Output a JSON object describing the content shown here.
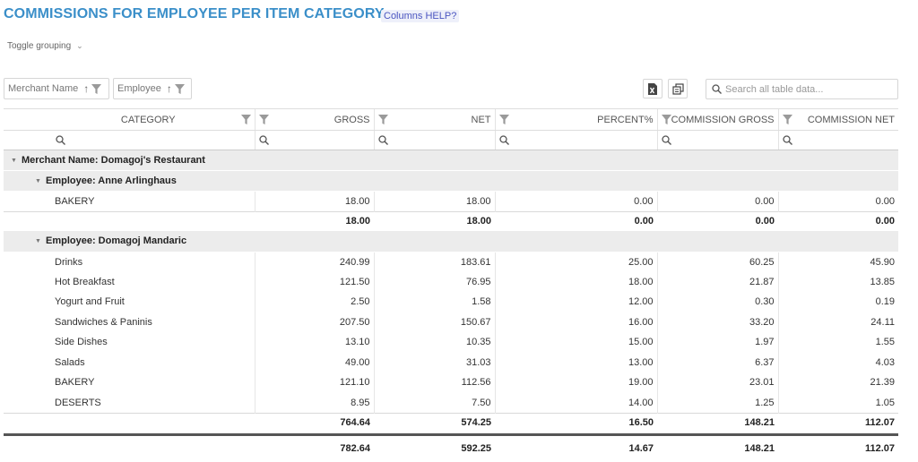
{
  "header": {
    "title": "COMMISSIONS FOR EMPLOYEE PER ITEM CATEGORY",
    "help_label": "Columns HELP?"
  },
  "toolbar": {
    "toggle_grouping": "Toggle grouping",
    "chips": [
      "Merchant Name",
      "Employee"
    ],
    "search_placeholder": "Search all table data..."
  },
  "columns": [
    "CATEGORY",
    "GROSS",
    "NET",
    "PERCENT%",
    "COMMISSION GROSS",
    "COMMISSION NET"
  ],
  "groups": [
    {
      "label": "Merchant Name: Domagoj's Restaurant",
      "employees": [
        {
          "label": "Employee: Anne Arlinghaus",
          "rows": [
            {
              "category": "BAKERY",
              "gross": "18.00",
              "net": "18.00",
              "percent": "0.00",
              "commission_gross": "0.00",
              "commission_net": "0.00"
            }
          ],
          "subtotal": {
            "gross": "18.00",
            "net": "18.00",
            "percent": "0.00",
            "commission_gross": "0.00",
            "commission_net": "0.00"
          }
        },
        {
          "label": "Employee: Domagoj Mandaric",
          "rows": [
            {
              "category": "Drinks",
              "gross": "240.99",
              "net": "183.61",
              "percent": "25.00",
              "commission_gross": "60.25",
              "commission_net": "45.90"
            },
            {
              "category": "Hot Breakfast",
              "gross": "121.50",
              "net": "76.95",
              "percent": "18.00",
              "commission_gross": "21.87",
              "commission_net": "13.85"
            },
            {
              "category": "Yogurt and Fruit",
              "gross": "2.50",
              "net": "1.58",
              "percent": "12.00",
              "commission_gross": "0.30",
              "commission_net": "0.19"
            },
            {
              "category": "Sandwiches & Paninis",
              "gross": "207.50",
              "net": "150.67",
              "percent": "16.00",
              "commission_gross": "33.20",
              "commission_net": "24.11"
            },
            {
              "category": "Side Dishes",
              "gross": "13.10",
              "net": "10.35",
              "percent": "15.00",
              "commission_gross": "1.97",
              "commission_net": "1.55"
            },
            {
              "category": "Salads",
              "gross": "49.00",
              "net": "31.03",
              "percent": "13.00",
              "commission_gross": "6.37",
              "commission_net": "4.03"
            },
            {
              "category": "BAKERY",
              "gross": "121.10",
              "net": "112.56",
              "percent": "19.00",
              "commission_gross": "23.01",
              "commission_net": "21.39"
            },
            {
              "category": "DESERTS",
              "gross": "8.95",
              "net": "7.50",
              "percent": "14.00",
              "commission_gross": "1.25",
              "commission_net": "1.05"
            }
          ],
          "subtotal": {
            "gross": "764.64",
            "net": "574.25",
            "percent": "16.50",
            "commission_gross": "148.21",
            "commission_net": "112.07"
          }
        }
      ]
    }
  ],
  "grand_total": {
    "gross": "782.64",
    "net": "592.25",
    "percent": "14.67",
    "commission_gross": "148.21",
    "commission_net": "112.07"
  },
  "colors": {
    "title": "#3b8fc9",
    "group_bg": "#ececec",
    "help_bg": "#eef0fa"
  },
  "icons": {
    "filter": "funnel-icon",
    "search": "magnifier-icon",
    "sort": "arrow-up-icon",
    "export_excel": "excel-icon",
    "columns": "columns-icon",
    "expand": "triangle-down-icon"
  }
}
